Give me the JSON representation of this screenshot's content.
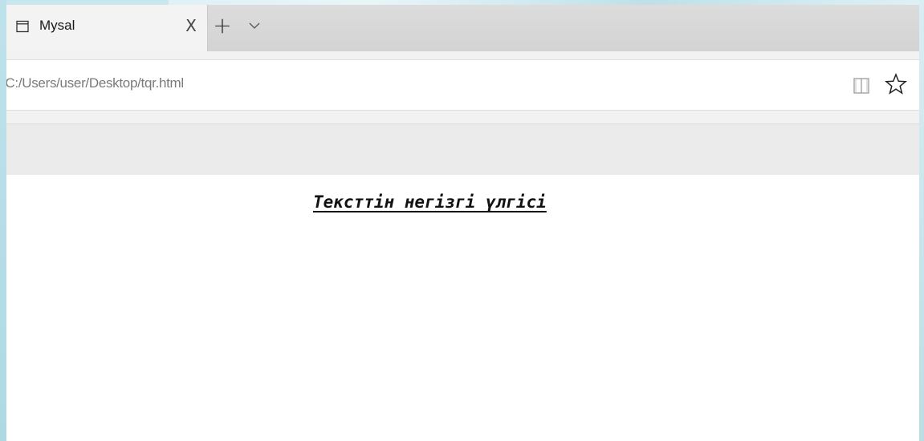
{
  "tabs": [
    {
      "title": "Mysal",
      "close_label": "X"
    }
  ],
  "tabbar": {
    "new_tab_label": "+"
  },
  "address_bar": {
    "url": "/C:/Users/user/Desktop/tqr.html"
  },
  "page": {
    "heading": "Тексттін негізгі үлгісі"
  },
  "icons": {
    "tab_icon": "window-icon",
    "tab_menu": "chevron-down-icon",
    "reading_view": "book-icon",
    "favorite": "star-icon"
  },
  "colors": {
    "tab_active": "#f3f3f3",
    "tabstrip": "#d6d6d6",
    "toolbar_band": "#ebebeb",
    "url_text": "#7a7a7a"
  }
}
